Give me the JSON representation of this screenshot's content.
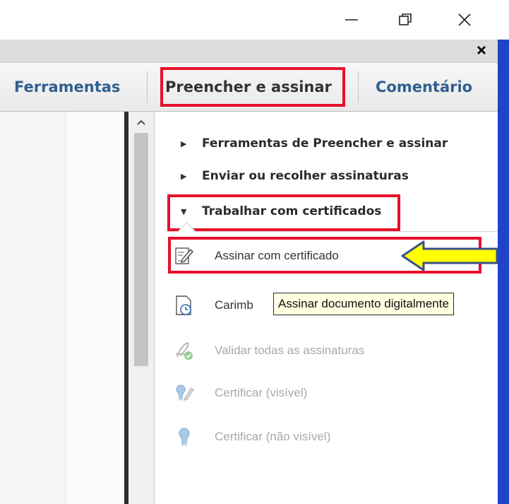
{
  "window": {
    "minimize_icon": "minimize-icon",
    "maximize_icon": "restore-icon",
    "close_icon": "close-icon"
  },
  "strip": {
    "close_icon": "close-x-icon"
  },
  "tabs": {
    "ferramentas": "Ferramentas",
    "preencher": "Preencher e assinar",
    "comentario": "Comentário"
  },
  "panel": {
    "sections": [
      {
        "label": "Ferramentas de Preencher e assinar",
        "state": "collapsed"
      },
      {
        "label": "Enviar ou recolher assinaturas",
        "state": "collapsed"
      },
      {
        "label": "Trabalhar com certificados",
        "state": "expanded"
      }
    ],
    "tools": [
      {
        "label": "Assinar com certificado",
        "icon": "sign-pen-icon",
        "enabled": true
      },
      {
        "label": "Carimb",
        "icon": "timestamp-clock-icon",
        "enabled": true
      },
      {
        "label": "Validar todas as assinaturas",
        "icon": "validate-signatures-icon",
        "enabled": false
      },
      {
        "label": "Certificar (visível)",
        "icon": "certify-visible-icon",
        "enabled": false
      },
      {
        "label": "Certificar (não visível)",
        "icon": "certify-invisible-icon",
        "enabled": false
      }
    ]
  },
  "tooltip": {
    "text": "Assinar documento digitalmente"
  },
  "colors": {
    "highlight": "#e8102a",
    "arrow_fill": "#ffff00",
    "arrow_stroke": "#3a4f8c",
    "tab_text": "#2f5f8f",
    "side_band": "#1f44c8"
  }
}
